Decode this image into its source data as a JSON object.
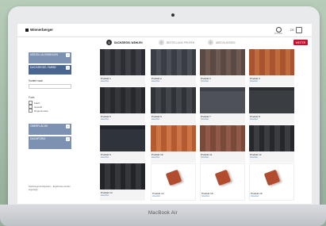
{
  "app": {
    "logo_text": "Wienerberger",
    "account_label": "Ihr Konto",
    "lang_label": "DE"
  },
  "steps": [
    {
      "num": "1",
      "label": "DACHZIEGEL WÄHLEN"
    },
    {
      "num": "2",
      "label": "BESTELLUNG PRÜFEN"
    },
    {
      "num": "3",
      "label": "ABSCHLIESSEN"
    }
  ],
  "next_label": "WEITER",
  "sidebar": {
    "filter1": "MODELL AUSWÄHLEN",
    "filter2": "DACHZIEGEL FARBE",
    "sort_label": "Sortiert nach",
    "shape_label": "Form",
    "checks": [
      "Flach",
      "Gewellt",
      "Doppelmulde"
    ],
    "filter3": "OBERFLÄCHE",
    "filter4": "DACHFORM",
    "note": "Dachziegel-Konfigurator – Ergebnisse werden angezeigt."
  },
  "products": [
    {
      "name": "Produkt 1",
      "sub": "Ansehen"
    },
    {
      "name": "Produkt 2",
      "sub": "Ansehen"
    },
    {
      "name": "Produkt 3",
      "sub": "Ansehen"
    },
    {
      "name": "Produkt 4",
      "sub": "Ansehen"
    },
    {
      "name": "Produkt 5",
      "sub": "Ansehen"
    },
    {
      "name": "Produkt 6",
      "sub": "Ansehen"
    },
    {
      "name": "Produkt 7",
      "sub": "Ansehen"
    },
    {
      "name": "Produkt 8",
      "sub": "Ansehen"
    },
    {
      "name": "Produkt 9",
      "sub": "Ansehen"
    },
    {
      "name": "Produkt 10",
      "sub": "Ansehen"
    },
    {
      "name": "Produkt 11",
      "sub": "Ansehen"
    },
    {
      "name": "Produkt 12",
      "sub": "Ansehen"
    },
    {
      "name": "Produkt 13",
      "sub": "Ansehen"
    },
    {
      "name": "Produkt 14",
      "sub": "Ansehen"
    },
    {
      "name": "Produkt 15",
      "sub": "Ansehen"
    },
    {
      "name": "Produkt 16",
      "sub": "Ansehen"
    }
  ],
  "laptop_brand": "MacBook Air",
  "colors": {
    "accent": "#c8102e",
    "filter_blue": "#7d92b3",
    "filter_dark": "#4a6590"
  }
}
